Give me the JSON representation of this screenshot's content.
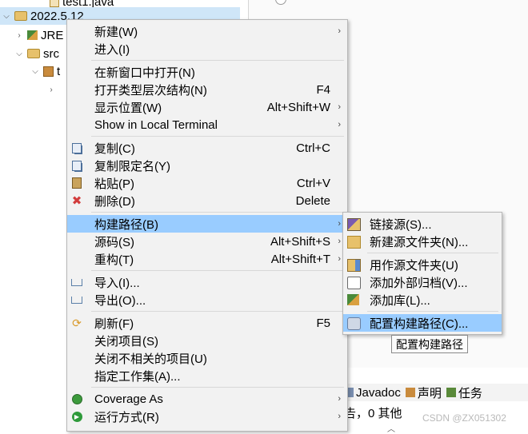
{
  "tree": {
    "partial_top": "test1.java",
    "project": "2022.5.12",
    "jre": "JRE",
    "src": "src",
    "pkg_partial": "t"
  },
  "menu": {
    "items": [
      {
        "label": "新建(W)",
        "accel": "",
        "arrow": "›"
      },
      {
        "label": "进入(I)",
        "accel": "",
        "arrow": ""
      },
      {
        "label": "在新窗口中打开(N)",
        "accel": "",
        "arrow": ""
      },
      {
        "label": "打开类型层次结构(N)",
        "accel": "F4",
        "arrow": ""
      },
      {
        "label": "显示位置(W)",
        "accel": "Alt+Shift+W",
        "arrow": "›"
      },
      {
        "label": "Show in Local Terminal",
        "accel": "",
        "arrow": "›"
      },
      {
        "label": "复制(C)",
        "accel": "Ctrl+C",
        "arrow": "",
        "icon": "copy-icon"
      },
      {
        "label": "复制限定名(Y)",
        "accel": "",
        "arrow": "",
        "icon": "copy-qualified-icon"
      },
      {
        "label": "粘贴(P)",
        "accel": "Ctrl+V",
        "arrow": "",
        "icon": "paste-icon"
      },
      {
        "label": "删除(D)",
        "accel": "Delete",
        "arrow": "",
        "icon": "delete-icon"
      },
      {
        "label": "构建路径(B)",
        "accel": "",
        "arrow": "›"
      },
      {
        "label": "源码(S)",
        "accel": "Alt+Shift+S",
        "arrow": "›"
      },
      {
        "label": "重构(T)",
        "accel": "Alt+Shift+T",
        "arrow": "›"
      },
      {
        "label": "导入(I)...",
        "accel": "",
        "arrow": "",
        "icon": "import-icon"
      },
      {
        "label": "导出(O)...",
        "accel": "",
        "arrow": "",
        "icon": "export-icon"
      },
      {
        "label": "刷新(F)",
        "accel": "F5",
        "arrow": "",
        "icon": "refresh-icon"
      },
      {
        "label": "关闭项目(S)",
        "accel": "",
        "arrow": ""
      },
      {
        "label": "关闭不相关的项目(U)",
        "accel": "",
        "arrow": ""
      },
      {
        "label": "指定工作集(A)...",
        "accel": "",
        "arrow": ""
      },
      {
        "label": "Coverage As",
        "accel": "",
        "arrow": "›",
        "icon": "coverage-icon"
      },
      {
        "label": "运行方式(R)",
        "accel": "",
        "arrow": "›",
        "icon": "run-icon"
      }
    ]
  },
  "submenu": {
    "items": [
      {
        "label": "链接源(S)...",
        "icon": "link-source-icon"
      },
      {
        "label": "新建源文件夹(N)...",
        "icon": "new-source-folder-icon"
      },
      {
        "label": "用作源文件夹(U)",
        "icon": "use-as-source-folder-icon"
      },
      {
        "label": "添加外部归档(V)...",
        "icon": "external-archive-icon"
      },
      {
        "label": "添加库(L)...",
        "icon": "library-icon"
      },
      {
        "label": "配置构建路径(C)...",
        "icon": "configure-build-path-icon"
      }
    ]
  },
  "tooltip": "配置构建路径",
  "bottom": {
    "tabs": [
      "Javadoc",
      "声明",
      "任务"
    ],
    "status": "告，0 其他"
  },
  "watermark": "CSDN @ZX051302",
  "colors": {
    "highlight": "#99ccff",
    "menu_bg": "#f2f2f2",
    "selection": "#cfe6f8"
  }
}
